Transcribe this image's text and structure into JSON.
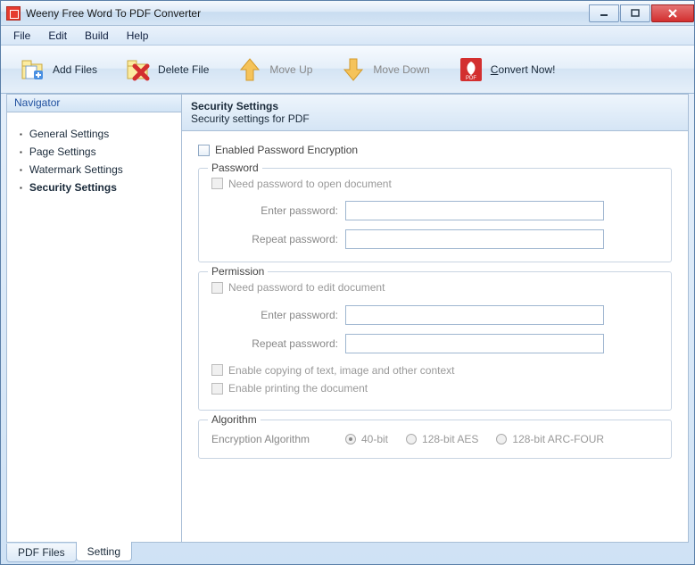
{
  "window": {
    "title": "Weeny Free Word To PDF Converter"
  },
  "menu": {
    "file": "File",
    "edit": "Edit",
    "build": "Build",
    "help": "Help"
  },
  "toolbar": {
    "add_files": "Add Files",
    "delete_file": "Delete File",
    "move_up": "Move Up",
    "move_down": "Move Down",
    "convert_now": "Convert Now!"
  },
  "sidebar": {
    "header": "Navigator",
    "items": [
      {
        "label": "General Settings"
      },
      {
        "label": "Page Settings"
      },
      {
        "label": "Watermark Settings"
      },
      {
        "label": "Security Settings"
      }
    ]
  },
  "panel": {
    "title": "Security Settings",
    "subtitle": "Security settings for PDF",
    "enable_encryption": "Enabled Password Encryption",
    "password": {
      "legend": "Password",
      "need_open": "Need password to open document",
      "enter": "Enter password:",
      "repeat": "Repeat password:"
    },
    "permission": {
      "legend": "Permission",
      "need_edit": "Need password to edit document",
      "enter": "Enter password:",
      "repeat": "Repeat password:",
      "enable_copy": "Enable copying of text, image and other context",
      "enable_print": "Enable printing the document"
    },
    "algorithm": {
      "legend": "Algorithm",
      "label": "Encryption Algorithm",
      "options": [
        "40-bit",
        "128-bit AES",
        "128-bit ARC-FOUR"
      ]
    }
  },
  "bottom_tabs": {
    "pdf_files": "PDF Files",
    "setting": "Setting"
  }
}
